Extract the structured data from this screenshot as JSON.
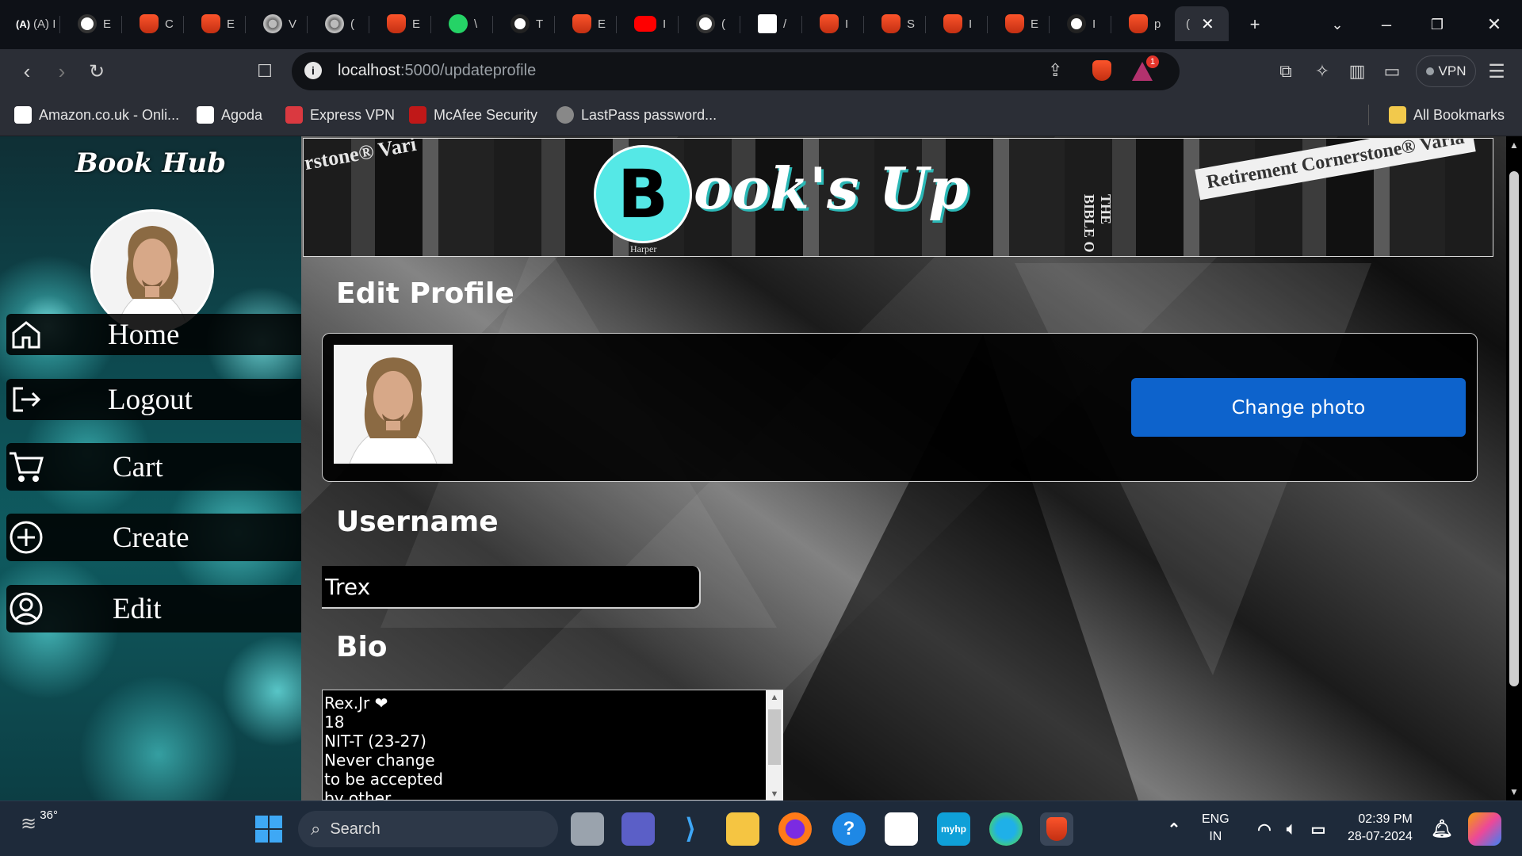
{
  "browser": {
    "tabs": [
      {
        "favicon": "aa-icon",
        "label": "(A) I"
      },
      {
        "favicon": "chatgpt-icon",
        "label": "E"
      },
      {
        "favicon": "brave-icon",
        "label": "C"
      },
      {
        "favicon": "brave-icon",
        "label": "E"
      },
      {
        "favicon": "globe-icon",
        "label": "V"
      },
      {
        "favicon": "globe-icon",
        "label": "("
      },
      {
        "favicon": "brave-icon",
        "label": "E"
      },
      {
        "favicon": "whatsapp-icon",
        "label": "\\"
      },
      {
        "favicon": "github-icon",
        "label": "T"
      },
      {
        "favicon": "brave-icon",
        "label": "E"
      },
      {
        "favicon": "youtube-icon",
        "label": "I"
      },
      {
        "favicon": "chatgpt-icon",
        "label": "("
      },
      {
        "favicon": "amazon-icon",
        "label": "/"
      },
      {
        "favicon": "brave-icon",
        "label": "I"
      },
      {
        "favicon": "brave-icon",
        "label": "S"
      },
      {
        "favicon": "brave-icon",
        "label": "I"
      },
      {
        "favicon": "brave-icon",
        "label": "E"
      },
      {
        "favicon": "github-icon",
        "label": "I"
      },
      {
        "favicon": "brave-icon",
        "label": "p"
      },
      {
        "favicon": "none",
        "label": "("
      }
    ],
    "url_host": "localhost",
    "url_path": ":5000/updateprofile",
    "vpn_label": "VPN",
    "shields_badge": "1",
    "bookmarks": [
      {
        "icon": "amazon-icon",
        "label": "Amazon.co.uk - Onli..."
      },
      {
        "icon": "agoda-icon",
        "label": "Agoda"
      },
      {
        "icon": "expressvpn-icon",
        "label": "Express VPN"
      },
      {
        "icon": "mcafee-icon",
        "label": "McAfee Security"
      },
      {
        "icon": "lastpass-icon",
        "label": "LastPass password..."
      }
    ],
    "all_bookmarks": "All Bookmarks"
  },
  "sidebar": {
    "brand": "Book Hub",
    "nav": [
      {
        "icon": "home-icon",
        "label": "Home"
      },
      {
        "icon": "logout-icon",
        "label": "Logout"
      },
      {
        "icon": "cart-icon",
        "label": "Cart"
      },
      {
        "icon": "plus-circle-icon",
        "label": "Create"
      },
      {
        "icon": "user-circle-icon",
        "label": "Edit"
      }
    ]
  },
  "banner": {
    "logo_letter": "B",
    "title": "ook's Up",
    "publisher": "Harper",
    "spine_texts": [
      "rstone® Vari",
      "THE BIBLE O",
      "Retirement Cornerstone® Varia"
    ]
  },
  "form": {
    "title": "Edit Profile",
    "change_photo": "Change photo",
    "username_label": "Username",
    "username_value": "Trex",
    "bio_label": "Bio",
    "bio_value": "Rex.Jr ❤\n18\nNIT-T (23-27)\nNever change\nto be accepted\nby other"
  },
  "taskbar": {
    "weather": "36°",
    "search_placeholder": "Search",
    "lang_top": "ENG",
    "lang_bottom": "IN",
    "time": "02:39 PM",
    "date": "28-07-2024"
  },
  "colors": {
    "accent_cyan": "#55e8e6",
    "button_blue": "#0d63cc"
  }
}
